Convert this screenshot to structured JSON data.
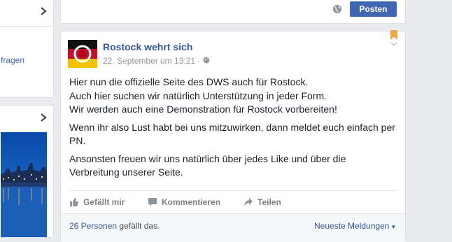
{
  "left": {
    "link_fragment": "fragen"
  },
  "composer": {
    "post_button": "Posten"
  },
  "post": {
    "page_name": "Rostock wehrt sich",
    "time": "22. September um 13:21 ·",
    "paragraphs": [
      "Hier nun die offizielle Seite des DWS auch für Rostock.",
      "Auch hier suchen wir natürlich Unterstützung in jeder Form.",
      "Wir werden auch eine Demonstration für Rostock vorbereiten!",
      "Wenn ihr also Lust habt bei uns mitzuwirken, dann meldet euch einfach per PN.",
      "Ansonsten freuen wir uns natürlich über jedes Like und über die Verbreitung unserer Seite."
    ],
    "actions": {
      "like": "Gefällt mir",
      "comment": "Kommentieren",
      "share": "Teilen"
    },
    "likes": {
      "link": "26 Personen",
      "suffix": " gefällt das."
    },
    "sort": "Neueste Meldungen"
  },
  "colors": {
    "brand_blue": "#4267b2",
    "link_blue": "#365899",
    "bookmark_orange": "#f0a54b"
  },
  "icons": [
    "chevron-right-icon",
    "globe-icon",
    "bookmark-icon",
    "chevron-down-icon",
    "thumbs-up-icon",
    "comment-icon",
    "share-icon"
  ]
}
